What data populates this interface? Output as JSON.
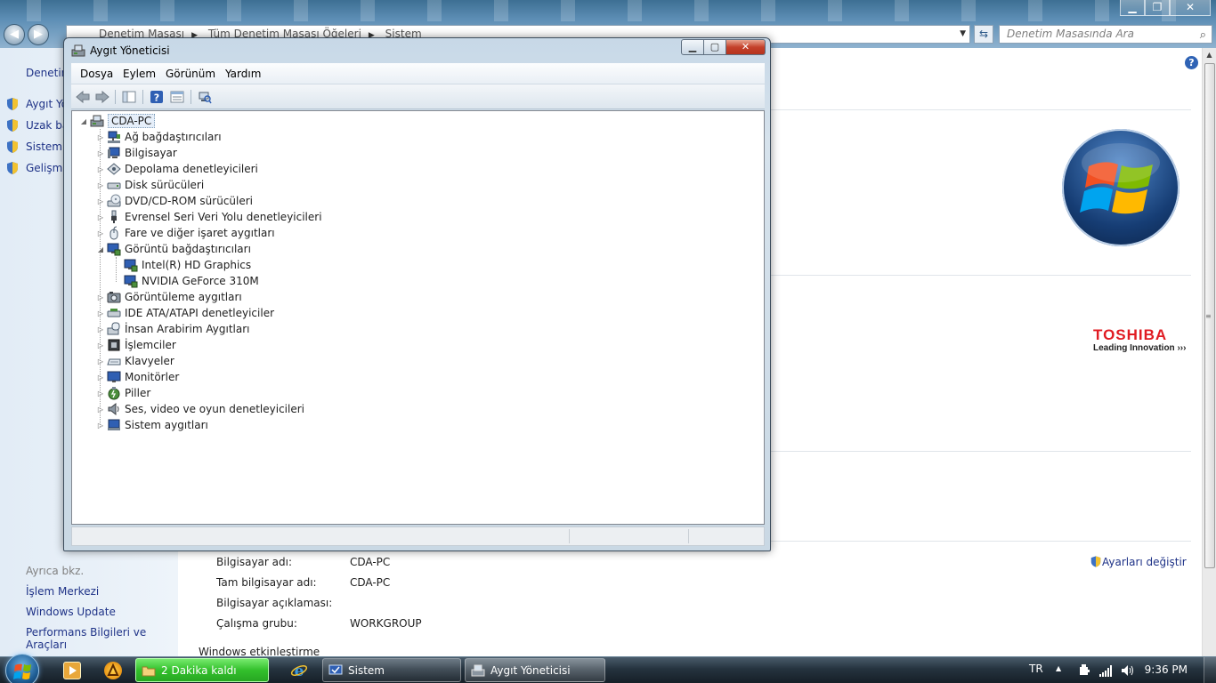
{
  "control_panel": {
    "address": {
      "crumbs": [
        "Denetim Masası",
        "Tüm Denetim Masası Öğeleri",
        "Sistem"
      ]
    },
    "search_placeholder": "Denetim Masasında Ara",
    "sidebar": {
      "home": "Denetim",
      "tasks": [
        {
          "label": "Aygıt Yö"
        },
        {
          "label": "Uzak ba"
        },
        {
          "label": "Sistem k"
        },
        {
          "label": "Gelişmiş"
        }
      ],
      "see_also_header": "Ayrıca bkz.",
      "see_also_links": [
        "İşlem Merkezi",
        "Windows Update",
        "Performans Bilgileri ve Araçları"
      ]
    },
    "computer_info": [
      {
        "label": "Bilgisayar adı:",
        "value": "CDA-PC"
      },
      {
        "label": "Tam bilgisayar adı:",
        "value": "CDA-PC"
      },
      {
        "label": "Bilgisayar açıklaması:",
        "value": ""
      },
      {
        "label": "Çalışma grubu:",
        "value": "WORKGROUP"
      }
    ],
    "change_settings": "Ayarları değiştir",
    "activation_heading": "Windows etkinleştirme",
    "oem": {
      "brand": "TOSHIBA",
      "tagline": "Leading Innovation"
    }
  },
  "device_manager": {
    "title": "Aygıt Yöneticisi",
    "menu": [
      "Dosya",
      "Eylem",
      "Görünüm",
      "Yardım"
    ],
    "tree": {
      "root": "CDA-PC",
      "categories": [
        {
          "label": "Ağ bağdaştırıcıları",
          "icon": "network-adapter-icon",
          "expanded": false
        },
        {
          "label": "Bilgisayar",
          "icon": "computer-icon",
          "expanded": false
        },
        {
          "label": "Depolama denetleyicileri",
          "icon": "storage-controller-icon",
          "expanded": false
        },
        {
          "label": "Disk sürücüleri",
          "icon": "disk-drive-icon",
          "expanded": false
        },
        {
          "label": "DVD/CD-ROM sürücüleri",
          "icon": "dvd-drive-icon",
          "expanded": false
        },
        {
          "label": "Evrensel Seri Veri Yolu denetleyicileri",
          "icon": "usb-icon",
          "expanded": false
        },
        {
          "label": "Fare ve diğer işaret aygıtları",
          "icon": "mouse-icon",
          "expanded": false
        },
        {
          "label": "Görüntü bağdaştırıcıları",
          "icon": "display-adapter-icon",
          "expanded": true,
          "children": [
            "Intel(R) HD Graphics",
            "NVIDIA GeForce 310M"
          ]
        },
        {
          "label": "Görüntüleme aygıtları",
          "icon": "imaging-device-icon",
          "expanded": false
        },
        {
          "label": "IDE ATA/ATAPI denetleyiciler",
          "icon": "ide-controller-icon",
          "expanded": false
        },
        {
          "label": "İnsan Arabirim Aygıtları",
          "icon": "hid-icon",
          "expanded": false
        },
        {
          "label": "İşlemciler",
          "icon": "processor-icon",
          "expanded": false
        },
        {
          "label": "Klavyeler",
          "icon": "keyboard-icon",
          "expanded": false
        },
        {
          "label": "Monitörler",
          "icon": "monitor-icon",
          "expanded": false
        },
        {
          "label": "Piller",
          "icon": "battery-icon",
          "expanded": false
        },
        {
          "label": "Ses, video ve oyun denetleyicileri",
          "icon": "sound-icon",
          "expanded": false
        },
        {
          "label": "Sistem aygıtları",
          "icon": "system-device-icon",
          "expanded": false
        }
      ]
    }
  },
  "taskbar": {
    "buttons": [
      {
        "label": "2 Dakika kaldı"
      },
      {
        "label": "Sistem"
      },
      {
        "label": "Aygıt Yöneticisi"
      }
    ],
    "language": "TR",
    "clock": "9:36 PM"
  }
}
